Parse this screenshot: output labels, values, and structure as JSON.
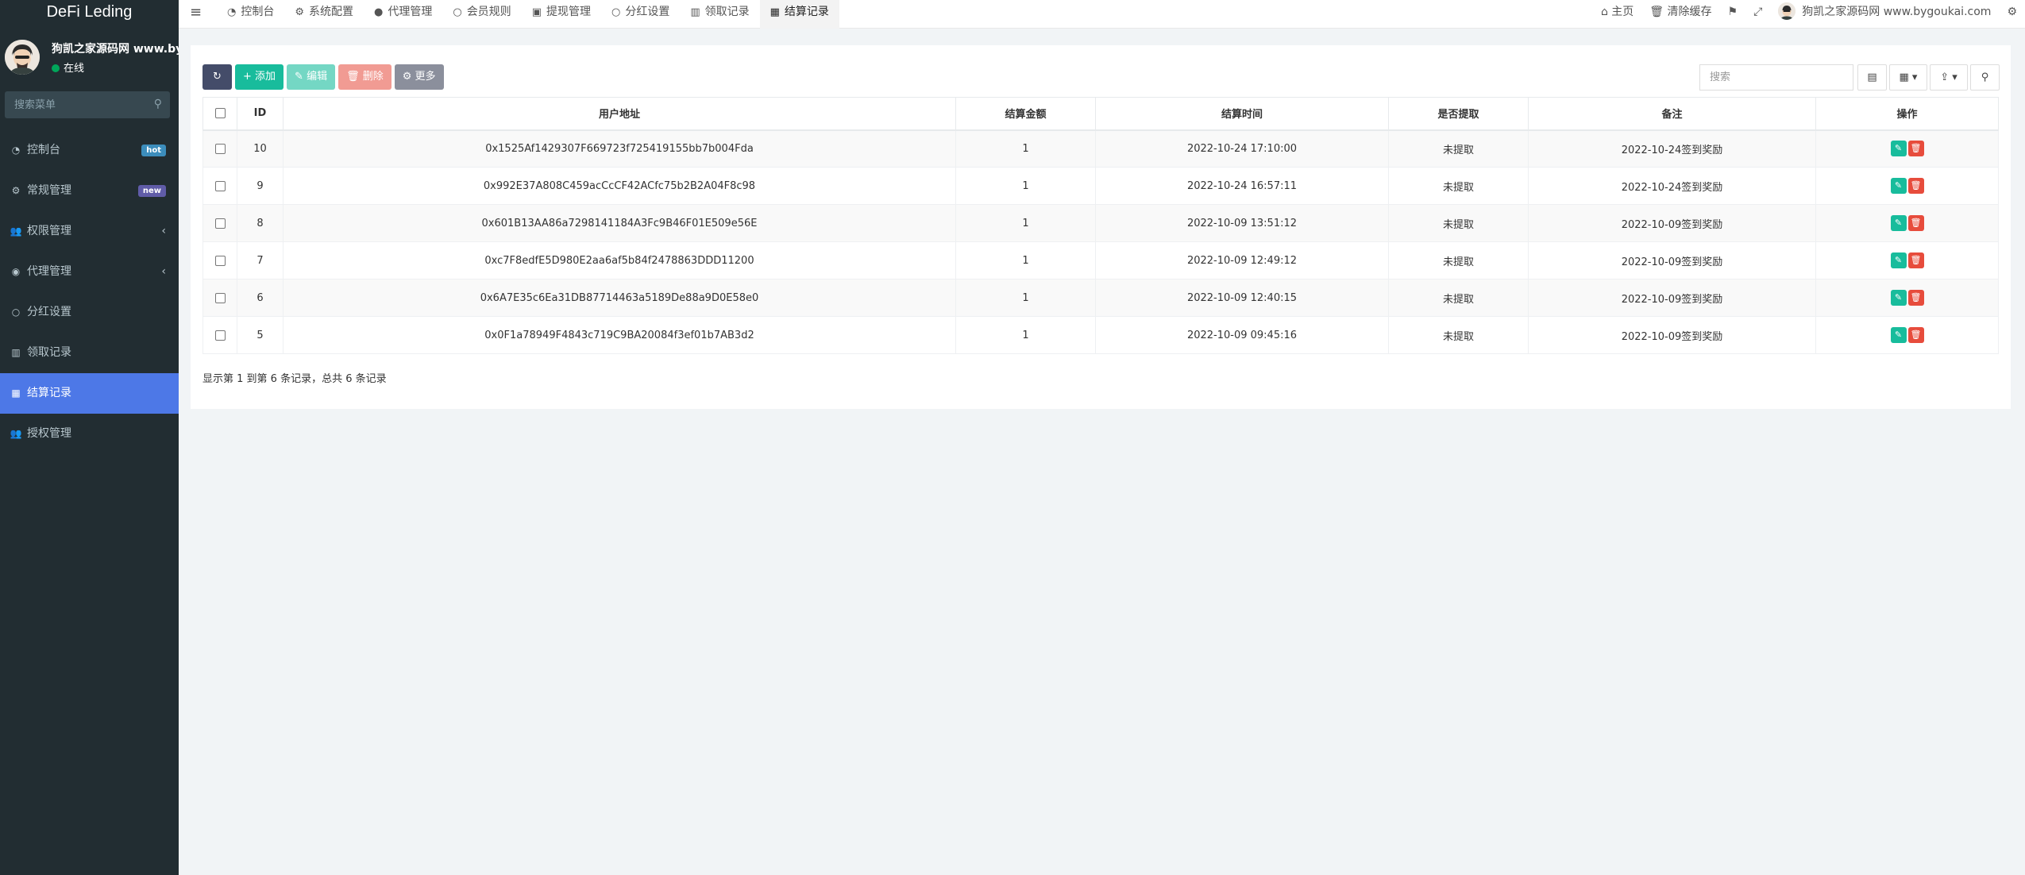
{
  "brand": "DeFi Leding",
  "user": {
    "name": "狗凯之家源码网 www.bygoukai.com",
    "status": "在线"
  },
  "sidebar_search": {
    "placeholder": "搜索菜单",
    "icon": "search-icon"
  },
  "menu": [
    {
      "label": "控制台",
      "icon": "dashboard-icon",
      "glyph": "◔",
      "badge": "hot",
      "badge_color": "#3c8dbc"
    },
    {
      "label": "常规管理",
      "icon": "cogs-icon",
      "glyph": "⚙",
      "badge": "new",
      "badge_color": "#605ca8"
    },
    {
      "label": "权限管理",
      "icon": "group-icon",
      "glyph": "👥",
      "chevron": "‹"
    },
    {
      "label": "代理管理",
      "icon": "user-circle-icon",
      "glyph": "◉",
      "chevron": "‹"
    },
    {
      "label": "分红设置",
      "icon": "circle-icon",
      "glyph": "○"
    },
    {
      "label": "领取记录",
      "icon": "bar-chart-icon",
      "glyph": "▥"
    },
    {
      "label": "结算记录",
      "icon": "table-icon",
      "glyph": "▦",
      "active": true
    },
    {
      "label": "授权管理",
      "icon": "group-icon",
      "glyph": "👥"
    }
  ],
  "topbar": {
    "toggle_icon": "menu-bars-icon",
    "tabs": [
      {
        "label": "控制台",
        "icon": "dashboard-icon",
        "glyph": "◔"
      },
      {
        "label": "系统配置",
        "icon": "gear-icon",
        "glyph": "⚙"
      },
      {
        "label": "代理管理",
        "icon": "user-icon",
        "glyph": "●"
      },
      {
        "label": "会员规则",
        "icon": "circle-icon",
        "glyph": "○"
      },
      {
        "label": "提现管理",
        "icon": "money-icon",
        "glyph": "▣"
      },
      {
        "label": "分红设置",
        "icon": "circle-icon",
        "glyph": "○"
      },
      {
        "label": "领取记录",
        "icon": "bar-chart-icon",
        "glyph": "▥"
      },
      {
        "label": "结算记录",
        "icon": "table-icon",
        "glyph": "▦",
        "active": true
      }
    ],
    "right": {
      "home": "主页",
      "clear_cache": "清除缓存",
      "username": "狗凯之家源码网 www.bygoukai.com"
    }
  },
  "toolbar": {
    "refresh_icon": "refresh-icon",
    "add": "添加",
    "edit": "编辑",
    "delete": "删除",
    "more": "更多",
    "search_placeholder": "搜索"
  },
  "table": {
    "columns": [
      "ID",
      "用户地址",
      "结算金额",
      "结算时间",
      "是否提取",
      "备注",
      "操作"
    ],
    "rows": [
      {
        "id": "10",
        "address": "0x1525Af1429307F669723f725419155bb7b004Fda",
        "amount": "1",
        "time": "2022-10-24 17:10:00",
        "withdrawn": "未提取",
        "note": "2022-10-24签到奖励"
      },
      {
        "id": "9",
        "address": "0x992E37A808C459acCcCF42ACfc75b2B2A04F8c98",
        "amount": "1",
        "time": "2022-10-24 16:57:11",
        "withdrawn": "未提取",
        "note": "2022-10-24签到奖励"
      },
      {
        "id": "8",
        "address": "0x601B13AA86a7298141184A3Fc9B46F01E509e56E",
        "amount": "1",
        "time": "2022-10-09 13:51:12",
        "withdrawn": "未提取",
        "note": "2022-10-09签到奖励"
      },
      {
        "id": "7",
        "address": "0xc7F8edfE5D980E2aa6af5b84f2478863DDD11200",
        "amount": "1",
        "time": "2022-10-09 12:49:12",
        "withdrawn": "未提取",
        "note": "2022-10-09签到奖励"
      },
      {
        "id": "6",
        "address": "0x6A7E35c6Ea31DB87714463a5189De88a9D0E58e0",
        "amount": "1",
        "time": "2022-10-09 12:40:15",
        "withdrawn": "未提取",
        "note": "2022-10-09签到奖励"
      },
      {
        "id": "5",
        "address": "0x0F1a78949F4843c719C9BA20084f3ef01b7AB3d2",
        "amount": "1",
        "time": "2022-10-09 09:45:16",
        "withdrawn": "未提取",
        "note": "2022-10-09签到奖励"
      }
    ]
  },
  "pagination_info": "显示第 1 到第 6 条记录，总共 6 条记录",
  "colors": {
    "sidebar_bg": "#222d32",
    "active_menu": "#4d78e7",
    "success": "#18bc9c",
    "danger": "#e74c3c",
    "dark_btn": "#444c69"
  }
}
